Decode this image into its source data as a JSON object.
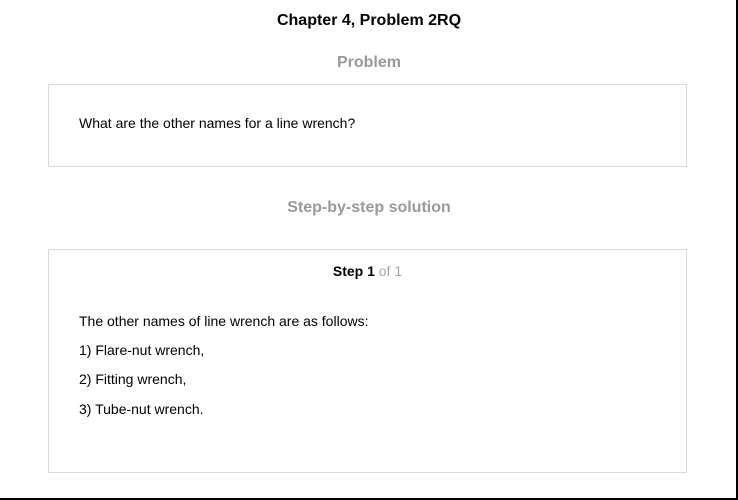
{
  "page": {
    "title": "Chapter 4, Problem 2RQ"
  },
  "problem": {
    "heading": "Problem",
    "text": "What are the other names for a line wrench?"
  },
  "solution": {
    "heading": "Step-by-step solution",
    "step_label": "Step 1",
    "step_of": " of 1",
    "intro": "The other names of line wrench are as follows:",
    "items": [
      "1) Flare-nut wrench,",
      "2) Fitting wrench,",
      "3) Tube-nut wrench."
    ]
  }
}
